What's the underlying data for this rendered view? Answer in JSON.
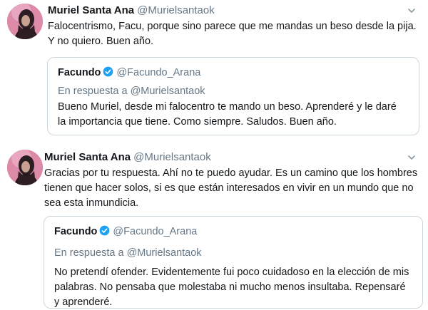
{
  "tweets": [
    {
      "author": {
        "name": "Muriel Santa Ana",
        "handle": "@Murielsantaok",
        "avatar_icon": "profile-photo"
      },
      "text": "Falocentrismo, Facu, porque sino parece que me mandas un beso desde la pija. Y no quiero. Buen año.",
      "quoted": {
        "name": "Facundo",
        "verified": true,
        "handle": "@Facundo_Arana",
        "reply_to": "En respuesta a @Murielsantaok",
        "text": "Bueno Muriel, desde mi falocentro te mando un beso. Aprenderé y le daré la importancia que tiene. Como siempre. Saludos. Buen año."
      }
    },
    {
      "author": {
        "name": "Muriel Santa Ana",
        "handle": "@Murielsantaok",
        "avatar_icon": "profile-photo"
      },
      "text": "Gracias por tu respuesta. Ahí no te puedo ayudar. Es un camino que los hombres tienen que hacer solos, si es que están interesados en vivir en un mundo que no sea esta inmundicia.",
      "quoted": {
        "name": "Facundo",
        "verified": true,
        "handle": "@Facundo_Arana",
        "reply_to": "En respuesta a @Murielsantaok",
        "text": "No pretendí ofender. Evidentemente fui poco cuidadoso en la elección de mis palabras. No pensaba que molestaba ni mucho menos insultaba. Repensaré y aprenderé."
      }
    }
  ],
  "colors": {
    "text": "#14171a",
    "secondary": "#657786",
    "border": "#ccd6dd",
    "verified": "#1da1f2",
    "avatar_bg": "#d982a0"
  }
}
